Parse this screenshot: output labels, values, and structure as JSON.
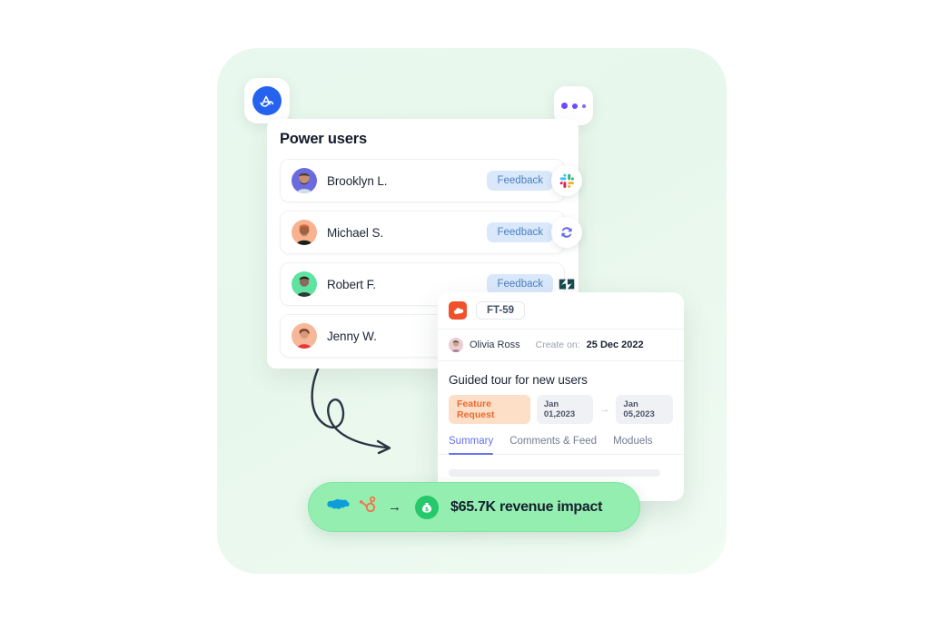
{
  "app": {
    "logo_icon": "analytics-wave-logo-icon",
    "more_icon": "more-dots-icon"
  },
  "power_users": {
    "title": "Power users",
    "rows": [
      {
        "name": "Brooklyn L.",
        "badge": "Feedback",
        "integration_icon": "slack-icon",
        "avatar_bg": "#6b6be0"
      },
      {
        "name": "Michael S.",
        "badge": "Feedback",
        "integration_icon": "sync-refresh-icon",
        "avatar_bg": "#f9b190"
      },
      {
        "name": "Robert F.",
        "badge": "Feedback",
        "integration_icon": "zendesk-icon",
        "avatar_bg": "#5fe3a1"
      },
      {
        "name": "Jenny W.",
        "badge": "",
        "integration_icon": "",
        "avatar_bg": "#f6b79a"
      }
    ]
  },
  "ticket": {
    "source_icon": "salesforce-cloud-icon",
    "id": "FT-59",
    "author_name": "Olivia Ross",
    "author_avatar_icon": "olivia-avatar",
    "created_label": "Create on:",
    "created_date": "25 Dec 2022",
    "title": "Guided tour for new users",
    "type_chip": "Feature Request",
    "date_start": "Jan 01,2023",
    "date_arrow_icon": "arrow-right-icon",
    "date_end": "Jan 05,2023",
    "tabs": [
      {
        "label": "Summary",
        "active": true
      },
      {
        "label": "Comments & Feed",
        "active": false
      },
      {
        "label": "Moduels",
        "active": false
      }
    ]
  },
  "revenue_pill": {
    "source_icons": [
      "salesforce-icon",
      "hubspot-icon"
    ],
    "arrow_icon": "arrow-right-icon",
    "bag_icon": "money-bag-icon",
    "text": "$65.7K revenue impact"
  },
  "decoration": {
    "curved_arrow_icon": "hand-drawn-curved-arrow-icon"
  },
  "colors": {
    "backdrop": "#e9f8ee",
    "accent_blue": "#2563ef",
    "badge_bg": "#d9e8fa",
    "badge_text": "#4a7fc1",
    "chip_orange_bg": "#fcdfc6",
    "chip_orange_text": "#eb6a33",
    "tab_active": "#6471ec",
    "pill_green": "#93eeb0",
    "bag_green": "#25c86a",
    "dots_purple": "#6d4aff"
  }
}
